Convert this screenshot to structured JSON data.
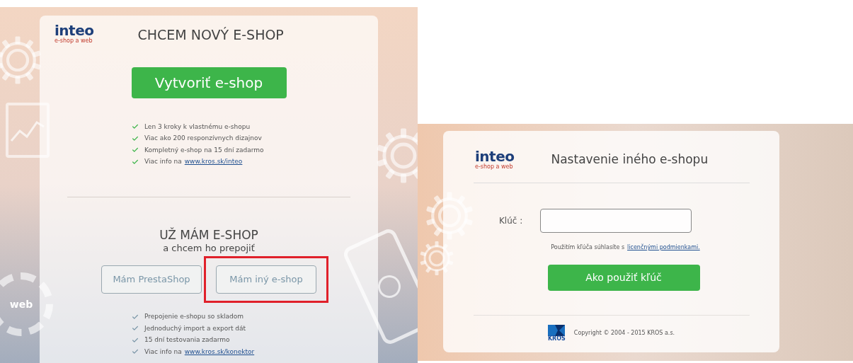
{
  "left_screen": {
    "logo": {
      "name": "inteo",
      "tagline": "e-shop a web"
    },
    "new_shop": {
      "title": "CHCEM NOVÝ E-SHOP",
      "button": "Vytvoriť e-shop",
      "features": [
        {
          "text": "Len 3 kroky k vlastnému e-shopu"
        },
        {
          "text": "Viac ako 200 responzívnych dizajnov"
        },
        {
          "text": "Kompletný e-shop na 15 dní zadarmo"
        },
        {
          "text": "Viac info na",
          "link": "www.kros.sk/inteo"
        }
      ]
    },
    "existing_shop": {
      "title": "UŽ MÁM E-SHOP",
      "subtitle": "a chcem ho prepojiť",
      "buttons": [
        {
          "label": "Mám PrestaShop",
          "highlighted": false
        },
        {
          "label": "Mám iný e-shop",
          "highlighted": true
        }
      ],
      "features": [
        {
          "text": "Prepojenie e-shopu so skladom"
        },
        {
          "text": "Jednoduchý import a export dát"
        },
        {
          "text": "15 dní testovania zadarmo"
        },
        {
          "text": "Viac info na",
          "link": "www.kros.sk/konektor"
        }
      ]
    },
    "gear_label": "web"
  },
  "right_screen": {
    "logo": {
      "name": "inteo",
      "tagline": "e-shop a web"
    },
    "title": "Nastavenie iného e-shopu",
    "key_label": "Klúč :",
    "consent": {
      "text": "Použitím kľúča súhlasíte s",
      "link": "licenčnými podmienkami."
    },
    "button": "Ako použiť kľúč",
    "footer": {
      "logo": "KROS",
      "copyright": "Copyright © 2004 - 2015 KROS a.s."
    }
  }
}
